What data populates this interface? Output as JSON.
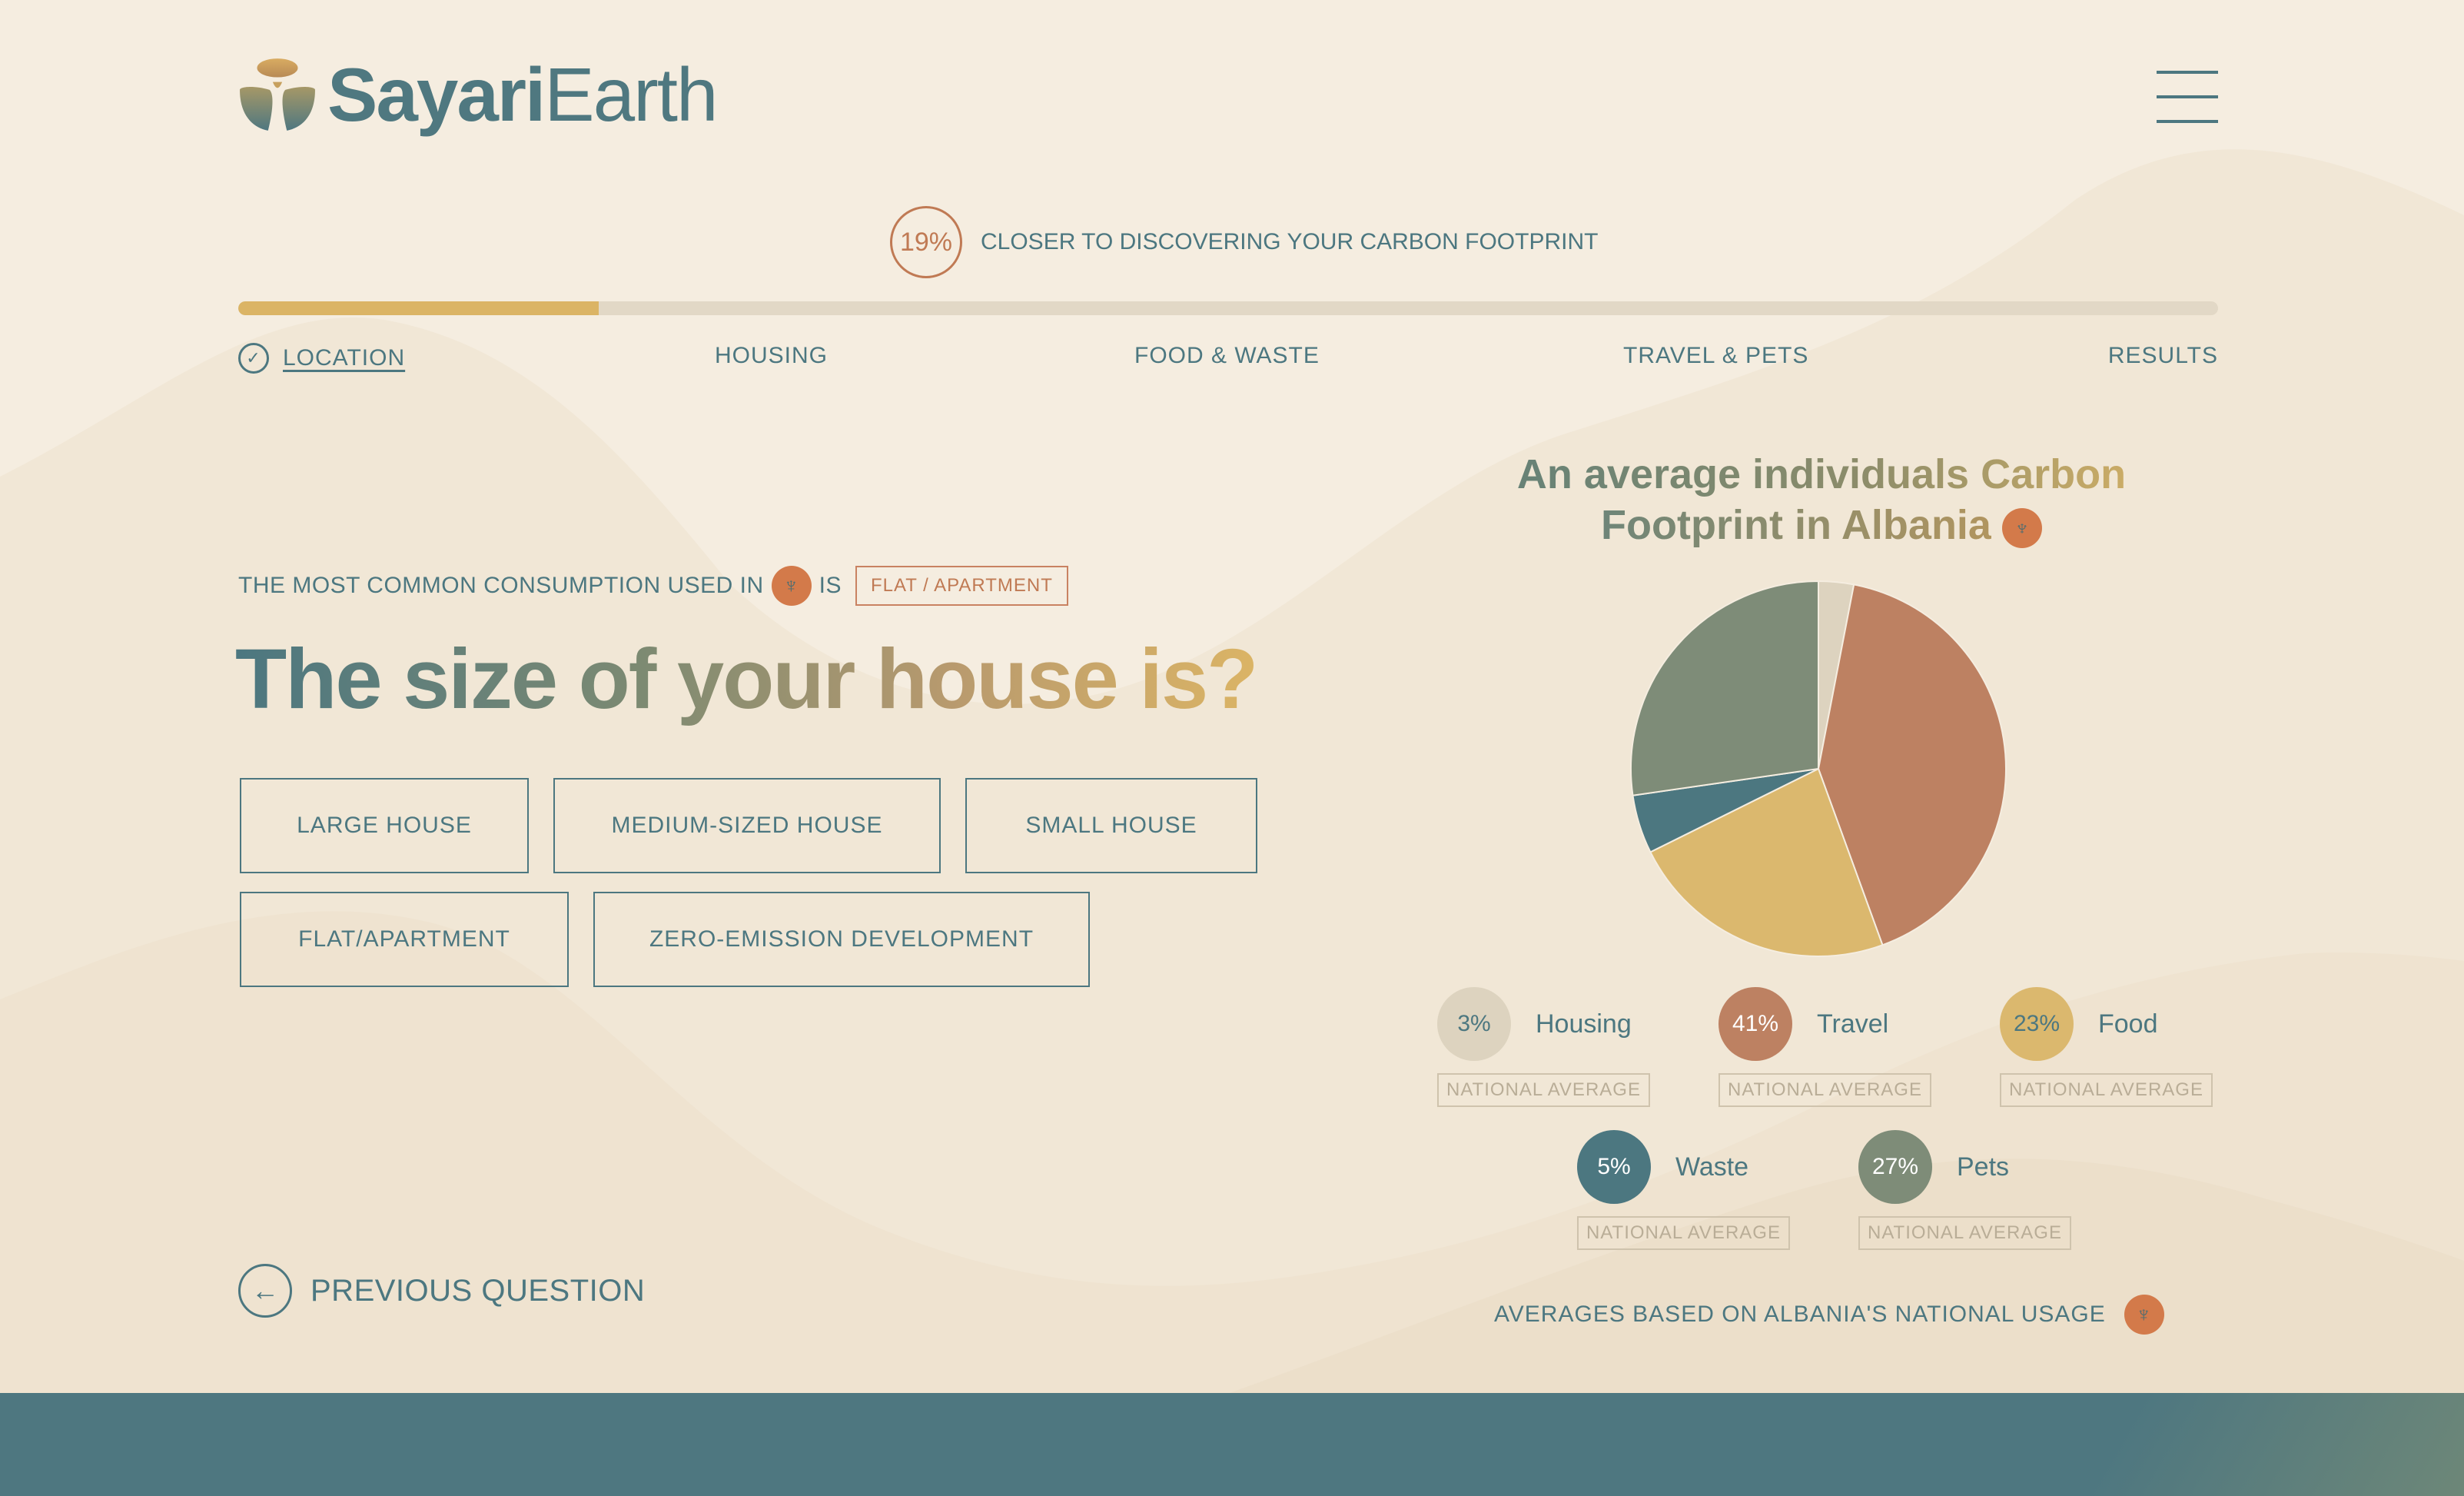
{
  "header": {
    "logo_bold": "Sayari",
    "logo_light": "Earth"
  },
  "progress": {
    "percent_label": "19%",
    "percent_value": 0.182,
    "text": "CLOSER TO DISCOVERING YOUR CARBON FOOTPRINT"
  },
  "steps": [
    {
      "label": "LOCATION",
      "done": true
    },
    {
      "label": "HOUSING"
    },
    {
      "label": "FOOD & WASTE"
    },
    {
      "label": "TRAVEL & PETS"
    },
    {
      "label": "RESULTS"
    }
  ],
  "question": {
    "common_prefix": "THE MOST COMMON CONSUMPTION USED IN",
    "common_is": "IS",
    "common_value": "FLAT / APARTMENT",
    "title": "The size of your house is?",
    "options": [
      "LARGE HOUSE",
      "MEDIUM-SIZED HOUSE",
      "SMALL HOUSE",
      "FLAT/APARTMENT",
      "ZERO-EMISSION DEVELOPMENT"
    ],
    "previous_label": "PREVIOUS QUESTION"
  },
  "panel": {
    "title_line1": "An average individuals Carbon",
    "title_line2": "Footprint in Albania",
    "footnote": "AVERAGES BASED ON ALBANIA'S NATIONAL USAGE",
    "national_average_label": "NATIONAL AVERAGE"
  },
  "chart_data": {
    "type": "pie",
    "slices": [
      {
        "name": "Housing",
        "label": "3%",
        "value": 3,
        "color": "#ddd3bf",
        "text_color": "#4c7780"
      },
      {
        "name": "Travel",
        "label": "41%",
        "value": 41,
        "color": "#bd8162",
        "text_color": "#ffffff"
      },
      {
        "name": "Food",
        "label": "23%",
        "value": 23,
        "color": "#dbb86e",
        "text_color": "#4c7780"
      },
      {
        "name": "Waste",
        "label": "5%",
        "value": 5,
        "color": "#4c7780",
        "text_color": "#ffffff"
      },
      {
        "name": "Pets",
        "label": "27%",
        "value": 27,
        "color": "#7e8c78",
        "text_color": "#ffffff"
      }
    ]
  },
  "colors": {
    "primary": "#4c7780",
    "accent_orange": "#c07a54",
    "accent_gold": "#dbb465",
    "background": "#f5ede0"
  },
  "icons": {
    "flag": "albania-flag-icon",
    "menu": "hamburger-menu-icon",
    "check": "check-circle-icon",
    "back": "arrow-left-icon"
  }
}
